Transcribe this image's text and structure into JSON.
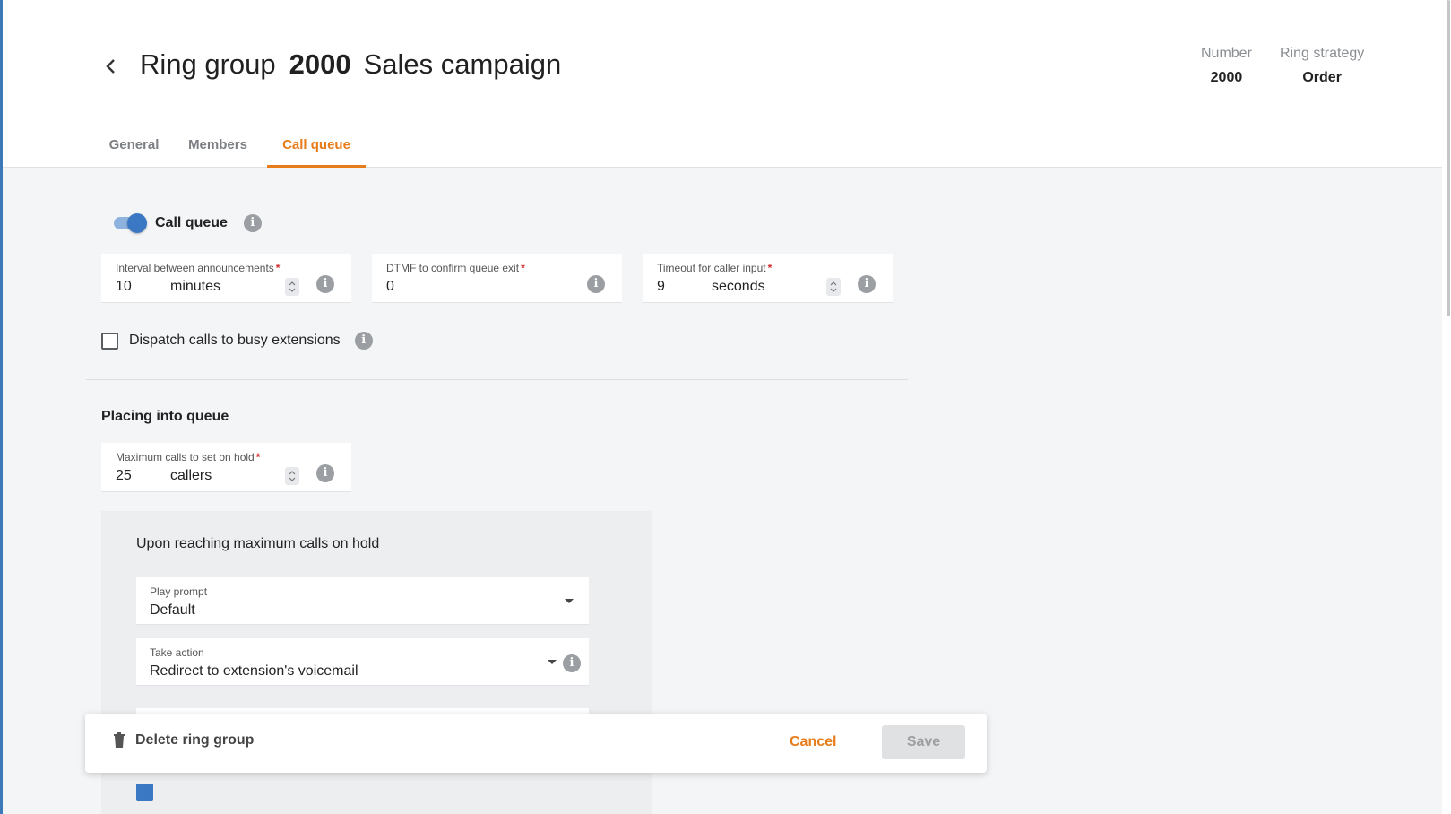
{
  "header": {
    "title_prefix": "Ring group",
    "title_number": "2000",
    "title_name": "Sales campaign",
    "meta": [
      {
        "label": "Number",
        "value": "2000"
      },
      {
        "label": "Ring strategy",
        "value": "Order"
      }
    ]
  },
  "tabs": [
    {
      "label": "General",
      "active": false
    },
    {
      "label": "Members",
      "active": false
    },
    {
      "label": "Call queue",
      "active": true
    }
  ],
  "call_queue": {
    "toggle_label": "Call queue",
    "toggle_on": true,
    "interval": {
      "label": "Interval between announcements",
      "required_mark": "*",
      "value": "10",
      "unit": "minutes"
    },
    "dtmf": {
      "label": "DTMF to confirm queue exit",
      "required_mark": "*",
      "value": "0"
    },
    "timeout": {
      "label": "Timeout for caller input",
      "required_mark": "*",
      "value": "9",
      "unit": "seconds"
    },
    "dispatch_busy": {
      "label": "Dispatch calls to busy extensions",
      "checked": false
    }
  },
  "placing": {
    "section_title": "Placing into queue",
    "max_calls": {
      "label": "Maximum calls to set on hold",
      "required_mark": "*",
      "value": "25",
      "unit": "callers"
    },
    "max_reached": {
      "title": "Upon reaching maximum calls on hold",
      "play_prompt": {
        "label": "Play prompt",
        "value": "Default"
      },
      "take_action": {
        "label": "Take action",
        "value": "Redirect to extension's voicemail"
      }
    }
  },
  "footer": {
    "delete_label": "Delete ring group",
    "cancel_label": "Cancel",
    "save_label": "Save"
  },
  "colors": {
    "accent": "#e77d1a",
    "toggle": "#3a78c3",
    "background": "#f4f5f7"
  },
  "icons": [
    "chevron-left-icon",
    "info-icon",
    "stepper-icon",
    "caret-down-icon",
    "trash-icon"
  ]
}
